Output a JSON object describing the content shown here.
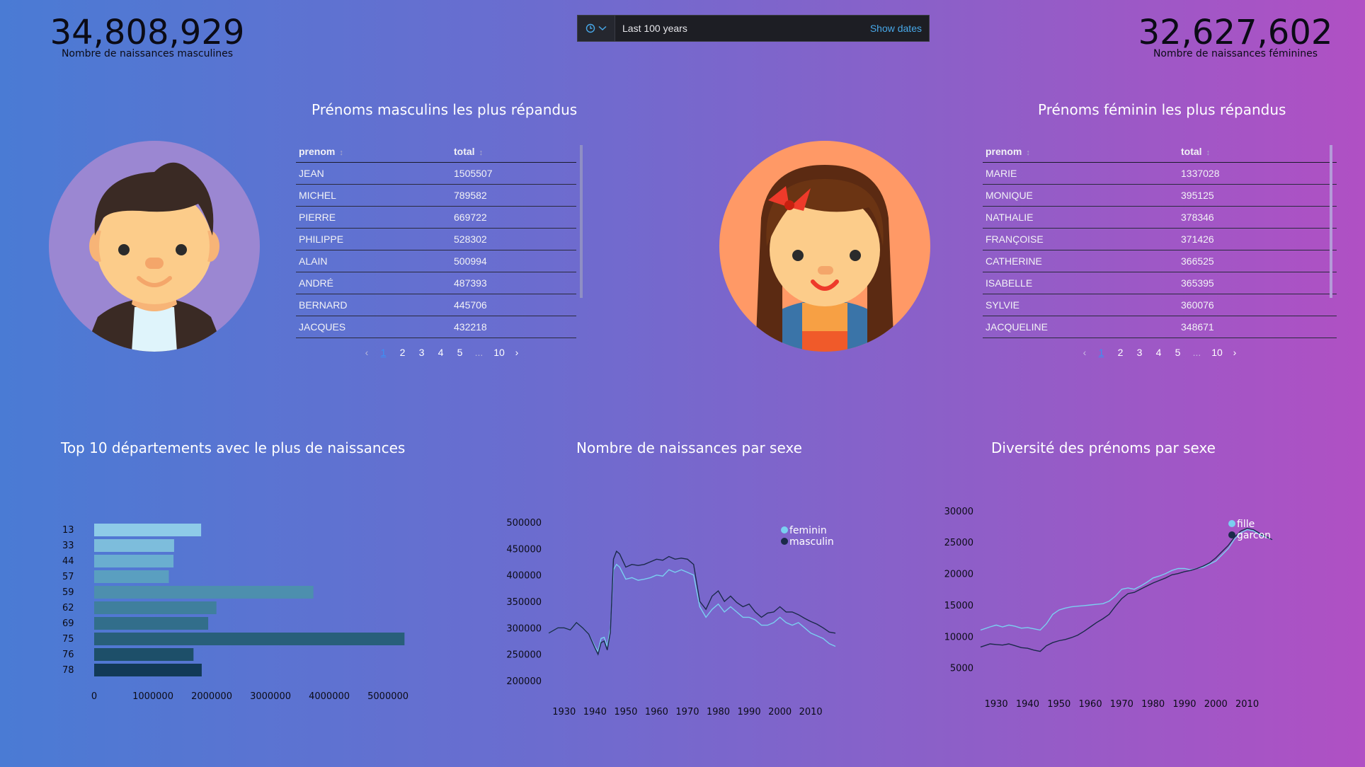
{
  "metrics": {
    "male_total": "34,808,929",
    "male_label": "Nombre de naissances masculines",
    "female_total": "32,627,602",
    "female_label": "Nombre de naissances féminines"
  },
  "timepicker": {
    "range_text": "Last 100 years",
    "show_dates_label": "Show dates",
    "icon": "clock-icon"
  },
  "male_table": {
    "title": "Prénoms masculins les plus répandus",
    "columns": [
      "prenom",
      "total"
    ],
    "rows": [
      [
        "JEAN",
        "1505507"
      ],
      [
        "MICHEL",
        "789582"
      ],
      [
        "PIERRE",
        "669722"
      ],
      [
        "PHILIPPE",
        "528302"
      ],
      [
        "ALAIN",
        "500994"
      ],
      [
        "ANDRÉ",
        "487393"
      ],
      [
        "BERNARD",
        "445706"
      ],
      [
        "JACQUES",
        "432218"
      ]
    ],
    "pages": [
      "1",
      "2",
      "3",
      "4",
      "5",
      "...",
      "10"
    ],
    "current_page": "1"
  },
  "female_table": {
    "title": "Prénoms féminin les plus répandus",
    "columns": [
      "prenom",
      "total"
    ],
    "rows": [
      [
        "MARIE",
        "1337028"
      ],
      [
        "MONIQUE",
        "395125"
      ],
      [
        "NATHALIE",
        "378346"
      ],
      [
        "FRANÇOISE",
        "371426"
      ],
      [
        "CATHERINE",
        "366525"
      ],
      [
        "ISABELLE",
        "365395"
      ],
      [
        "SYLVIE",
        "360076"
      ],
      [
        "JACQUELINE",
        "348671"
      ]
    ],
    "pages": [
      "1",
      "2",
      "3",
      "4",
      "5",
      "...",
      "10"
    ],
    "current_page": "1"
  },
  "colors": {
    "bar_palette": [
      "#8ecbe8",
      "#7dbddc",
      "#6aaed0",
      "#5a9fc0",
      "#4d8fae",
      "#3f7f9d",
      "#326e8b",
      "#285f7a",
      "#1d4f69",
      "#123a57"
    ],
    "line_feminin": "#7ad0f0",
    "line_masculin": "#1b2a4a",
    "male_avatar_bg": "#9b87d2",
    "female_avatar_bg": "#ff9966"
  },
  "chart_data": [
    {
      "type": "bar",
      "orientation": "horizontal",
      "title": "Top 10 départements avec le plus de naissances",
      "categories": [
        "13",
        "33",
        "44",
        "57",
        "59",
        "62",
        "69",
        "75",
        "76",
        "78"
      ],
      "values": [
        1820000,
        1360000,
        1350000,
        1270000,
        3730000,
        2080000,
        1940000,
        5280000,
        1690000,
        1830000
      ],
      "xlim": [
        0,
        5300000
      ],
      "xticks": [
        "0",
        "1000000",
        "2000000",
        "3000000",
        "4000000",
        "5000000"
      ],
      "grid": false,
      "legend": "none"
    },
    {
      "type": "line",
      "title": "Nombre de naissances par sexe",
      "x": [
        1925,
        1928,
        1930,
        1932,
        1934,
        1936,
        1938,
        1940,
        1941,
        1942,
        1943,
        1944,
        1945,
        1946,
        1947,
        1948,
        1950,
        1952,
        1954,
        1956,
        1958,
        1960,
        1962,
        1964,
        1966,
        1968,
        1970,
        1972,
        1974,
        1976,
        1978,
        1980,
        1982,
        1984,
        1986,
        1988,
        1990,
        1992,
        1994,
        1996,
        1998,
        2000,
        2002,
        2004,
        2006,
        2008,
        2010,
        2012,
        2014,
        2016,
        2018
      ],
      "series": [
        {
          "name": "feminin",
          "values": [
            290000,
            300000,
            300000,
            296000,
            310000,
            300000,
            288000,
            265000,
            255000,
            280000,
            282000,
            265000,
            300000,
            410000,
            420000,
            415000,
            392000,
            395000,
            390000,
            392000,
            395000,
            400000,
            398000,
            410000,
            405000,
            410000,
            405000,
            400000,
            340000,
            320000,
            335000,
            345000,
            330000,
            340000,
            330000,
            320000,
            320000,
            315000,
            305000,
            305000,
            310000,
            320000,
            310000,
            305000,
            310000,
            300000,
            290000,
            285000,
            280000,
            270000,
            265000
          ]
        },
        {
          "name": "masculin",
          "values": [
            290000,
            300000,
            300000,
            296000,
            310000,
            300000,
            288000,
            262000,
            250000,
            272000,
            275000,
            258000,
            292000,
            430000,
            445000,
            440000,
            415000,
            420000,
            418000,
            420000,
            425000,
            430000,
            428000,
            435000,
            430000,
            432000,
            430000,
            420000,
            350000,
            335000,
            360000,
            370000,
            350000,
            360000,
            348000,
            340000,
            345000,
            330000,
            320000,
            328000,
            330000,
            340000,
            330000,
            330000,
            325000,
            318000,
            312000,
            307000,
            300000,
            292000,
            290000
          ]
        }
      ],
      "ylim": [
        200000,
        500000
      ],
      "yticks": [
        "200000",
        "250000",
        "300000",
        "350000",
        "400000",
        "450000",
        "500000"
      ],
      "xticks": [
        "1930",
        "1940",
        "1950",
        "1960",
        "1970",
        "1980",
        "1990",
        "2000",
        "2010"
      ],
      "legend": "top-right",
      "grid": false
    },
    {
      "type": "line",
      "title": "Diversité des prénoms par sexe",
      "x": [
        1925,
        1928,
        1930,
        1932,
        1934,
        1936,
        1938,
        1940,
        1942,
        1944,
        1946,
        1948,
        1950,
        1952,
        1954,
        1956,
        1958,
        1960,
        1962,
        1964,
        1966,
        1968,
        1970,
        1972,
        1974,
        1976,
        1978,
        1980,
        1982,
        1984,
        1986,
        1988,
        1990,
        1992,
        1994,
        1996,
        1998,
        2000,
        2002,
        2004,
        2006,
        2008,
        2010,
        2012,
        2014,
        2016,
        2018
      ],
      "series": [
        {
          "name": "fille",
          "values": [
            11000,
            11500,
            11800,
            11500,
            11800,
            11600,
            11300,
            11400,
            11200,
            11000,
            12000,
            13500,
            14200,
            14500,
            14700,
            14800,
            14900,
            15000,
            15100,
            15200,
            15600,
            16400,
            17500,
            17700,
            17500,
            18000,
            18600,
            19300,
            19600,
            20000,
            20500,
            20800,
            20800,
            20600,
            20800,
            21000,
            21500,
            22000,
            23000,
            24000,
            25500,
            26500,
            27000,
            26800,
            26200,
            25800,
            25400
          ]
        },
        {
          "name": "garcon",
          "values": [
            8300,
            8800,
            8700,
            8600,
            8800,
            8500,
            8200,
            8100,
            7800,
            7600,
            8500,
            9000,
            9300,
            9500,
            9800,
            10200,
            10800,
            11500,
            12200,
            12800,
            13500,
            14800,
            16000,
            16800,
            17000,
            17500,
            18000,
            18500,
            18900,
            19300,
            19800,
            20000,
            20300,
            20500,
            20800,
            21200,
            21700,
            22500,
            23500,
            24500,
            25800,
            26800,
            27200,
            27000,
            26400,
            25900,
            25400
          ]
        }
      ],
      "ylim": [
        3500,
        31000
      ],
      "yticks": [
        "5000",
        "10000",
        "15000",
        "20000",
        "25000",
        "30000"
      ],
      "xticks": [
        "1930",
        "1940",
        "1950",
        "1960",
        "1970",
        "1980",
        "1990",
        "2000",
        "2010"
      ],
      "legend": "top-right",
      "grid": false
    }
  ]
}
